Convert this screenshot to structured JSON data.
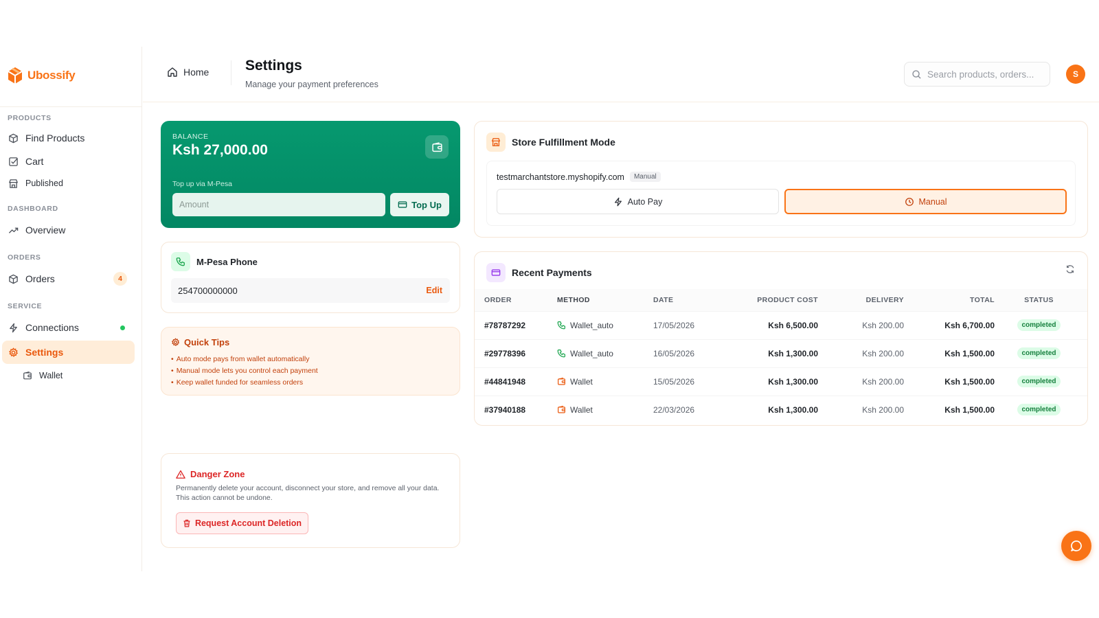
{
  "brand": {
    "name": "Ubossify",
    "accent": "#f97316"
  },
  "sidebar": {
    "sections": [
      {
        "label": "PRODUCTS"
      },
      {
        "label": "DASHBOARD"
      },
      {
        "label": "ORDERS"
      },
      {
        "label": "SERVICE"
      }
    ],
    "items": [
      {
        "label": "Find Products",
        "icon": "box-icon"
      },
      {
        "label": "Cart",
        "icon": "check-square-icon"
      },
      {
        "label": "Published",
        "icon": "store-icon"
      },
      {
        "label": "Overview",
        "icon": "trend-icon"
      },
      {
        "label": "Orders",
        "icon": "box-icon",
        "badge": "4"
      },
      {
        "label": "Connections",
        "icon": "zap-icon",
        "status": "online"
      },
      {
        "label": "Settings",
        "icon": "gear-icon",
        "active": true
      },
      {
        "label": "Wallet",
        "icon": "wallet-icon"
      }
    ]
  },
  "header": {
    "home_label": "Home",
    "title": "Settings",
    "subtitle": "Manage your payment preferences",
    "search_placeholder": "Search products, orders...",
    "avatar_initial": "S"
  },
  "balance": {
    "label": "BALANCE",
    "amount": "Ksh 27,000.00",
    "topup_label": "Top up via M-Pesa",
    "amount_placeholder": "Amount",
    "topup_button": "Top Up"
  },
  "mpesa": {
    "title": "M-Pesa Phone",
    "phone": "254700000000",
    "edit_label": "Edit"
  },
  "tips": {
    "title": "Quick Tips",
    "items": [
      "Auto mode pays from wallet automatically",
      "Manual mode lets you control each payment",
      "Keep wallet funded for seamless orders"
    ]
  },
  "danger": {
    "title": "Danger Zone",
    "text": "Permanently delete your account, disconnect your store, and remove all your data. This action cannot be undone.",
    "button": "Request Account Deletion"
  },
  "fulfillment": {
    "title": "Store Fulfillment Mode",
    "store": "testmarchantstore.myshopify.com",
    "current_mode": "Manual",
    "auto_label": "Auto Pay",
    "manual_label": "Manual"
  },
  "payments": {
    "title": "Recent Payments",
    "columns": [
      "ORDER",
      "METHOD",
      "DATE",
      "PRODUCT COST",
      "DELIVERY",
      "TOTAL",
      "STATUS"
    ],
    "rows": [
      {
        "order": "#78787292",
        "method": "Wallet_auto",
        "method_icon": "phone-icon",
        "date": "17/05/2026",
        "cost": "Ksh 6,500.00",
        "delivery": "Ksh 200.00",
        "total": "Ksh 6,700.00",
        "status": "completed"
      },
      {
        "order": "#29778396",
        "method": "Wallet_auto",
        "method_icon": "phone-icon",
        "date": "16/05/2026",
        "cost": "Ksh 1,300.00",
        "delivery": "Ksh 200.00",
        "total": "Ksh 1,500.00",
        "status": "completed"
      },
      {
        "order": "#44841948",
        "method": "Wallet",
        "method_icon": "wallet-icon",
        "date": "15/05/2026",
        "cost": "Ksh 1,300.00",
        "delivery": "Ksh 200.00",
        "total": "Ksh 1,500.00",
        "status": "completed"
      },
      {
        "order": "#37940188",
        "method": "Wallet",
        "method_icon": "wallet-icon",
        "date": "22/03/2026",
        "cost": "Ksh 1,300.00",
        "delivery": "Ksh 200.00",
        "total": "Ksh 1,500.00",
        "status": "completed"
      }
    ]
  }
}
